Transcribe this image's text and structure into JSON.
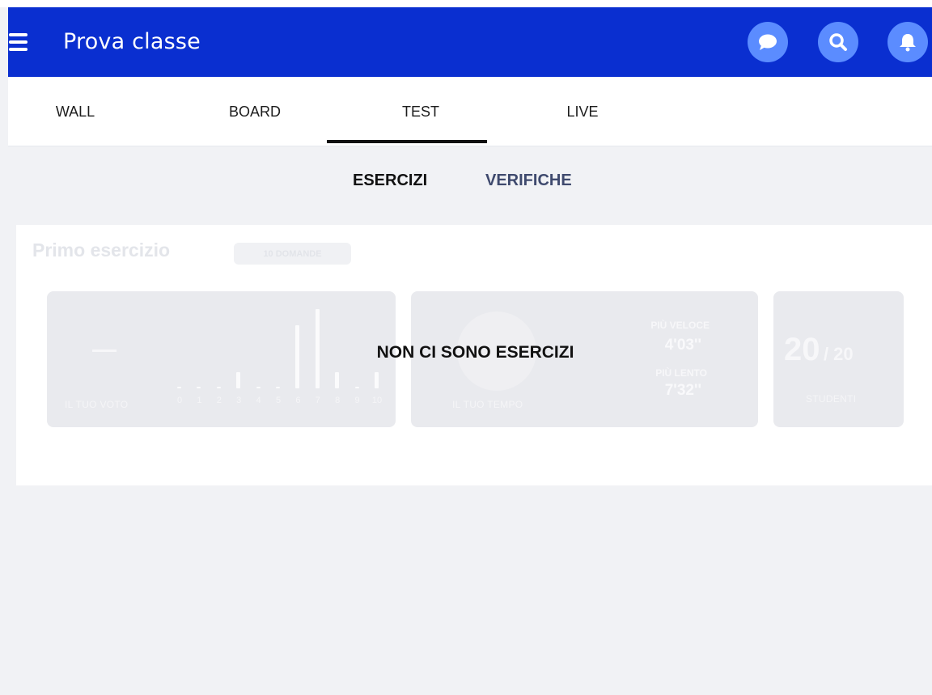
{
  "header": {
    "title": "Prova classe",
    "icons": [
      "menu-icon",
      "chat-icon",
      "search-icon",
      "bell-icon"
    ],
    "accent_color": "#0a2fd0",
    "icon_bg_color": "#5b8cff"
  },
  "tabs": [
    {
      "label": "WALL",
      "active": false
    },
    {
      "label": "BOARD",
      "active": false
    },
    {
      "label": "TEST",
      "active": true
    },
    {
      "label": "LIVE",
      "active": false
    }
  ],
  "subtabs": [
    {
      "label": "ESERCIZI",
      "active": true
    },
    {
      "label": "VERIFICHE",
      "active": false
    }
  ],
  "exercise": {
    "title": "Primo esercizio",
    "badge": "10 DOMANDE",
    "grade": {
      "value": "—",
      "label": "IL TUO VOTO",
      "histogram_labels": [
        "0",
        "1",
        "2",
        "3",
        "4",
        "5",
        "6",
        "7",
        "8",
        "9",
        "10"
      ],
      "histogram_values": [
        0,
        0,
        0,
        1,
        0,
        0,
        4,
        5,
        1,
        0,
        1
      ]
    },
    "time": {
      "label": "IL TUO TEMPO",
      "fastest_label": "PIÙ VELOCE",
      "fastest_value": "4'03''",
      "slowest_label": "PIÙ LENTO",
      "slowest_value": "7'32''"
    },
    "students": {
      "count": "20",
      "total": "/ 20",
      "label": "STUDENTI"
    }
  },
  "empty_message": "NON CI SONO ESERCIZI"
}
